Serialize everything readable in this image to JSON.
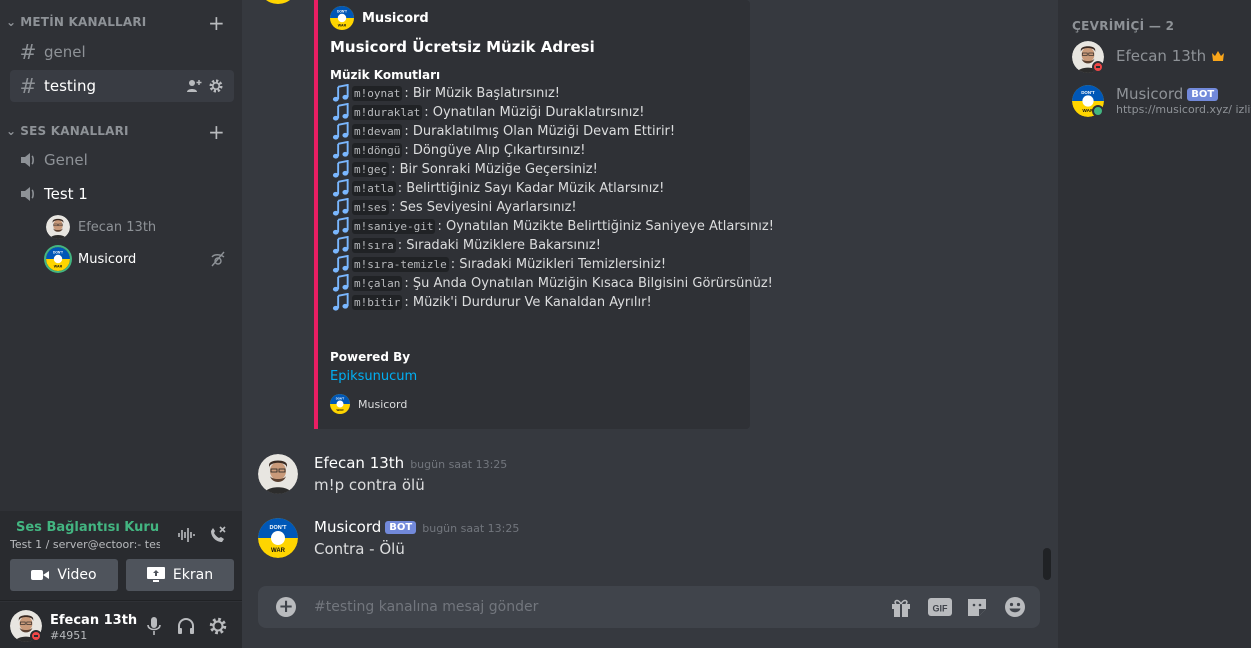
{
  "sidebar": {
    "text_category": "METİN KANALLARI",
    "voice_category": "SES KANALLARI",
    "text_channels": [
      {
        "label": "genel"
      },
      {
        "label": "testing"
      }
    ],
    "voice_channels": [
      {
        "label": "Genel"
      },
      {
        "label": "Test 1"
      }
    ],
    "voice_users": [
      {
        "name": "Efecan 13th"
      },
      {
        "name": "Musicord"
      }
    ]
  },
  "voice_panel": {
    "status": "Ses Bağlantısı Kuruldu",
    "subtitle": "Test 1 / server@ectoor:- tes...",
    "video_label": "Video",
    "screen_label": "Ekran"
  },
  "user_panel": {
    "name": "Efecan 13th",
    "tag": "#4951"
  },
  "embed": {
    "author": "Musicord",
    "title": "Musicord Ücretsiz Müzik Adresi",
    "field_name": "Müzik Komutları",
    "commands": [
      {
        "cmd": "m!oynat",
        "desc": ": Bir Müzik Başlatırsınız!"
      },
      {
        "cmd": "m!duraklat",
        "desc": ": Oynatılan Müziği Duraklatırsınız!"
      },
      {
        "cmd": "m!devam",
        "desc": ": Duraklatılmış Olan Müziği Devam Ettirir!"
      },
      {
        "cmd": "m!döngü",
        "desc": ": Döngüye Alıp Çıkartırsınız!"
      },
      {
        "cmd": "m!geç",
        "desc": ": Bir Sonraki Müziğe Geçersiniz!"
      },
      {
        "cmd": "m!atla",
        "desc": ": Belirttiğiniz Sayı Kadar Müzik Atlarsınız!"
      },
      {
        "cmd": "m!ses",
        "desc": ": Ses Seviyesini Ayarlarsınız!"
      },
      {
        "cmd": "m!saniye-git",
        "desc": ": Oynatılan Müzikte Belirttiğiniz Saniyeye Atlarsınız!"
      },
      {
        "cmd": "m!sıra",
        "desc": ": Sıradaki Müziklere Bakarsınız!"
      },
      {
        "cmd": "m!sıra-temizle",
        "desc": ": Sıradaki Müzikleri Temizlersiniz!"
      },
      {
        "cmd": "m!çalan",
        "desc": ": Şu Anda Oynatılan Müziğin Kısaca Bilgisini Görürsünüz!"
      },
      {
        "cmd": "m!bitir",
        "desc": ": Müzik'i Durdurur Ve Kanaldan Ayrılır!"
      }
    ],
    "powered_by": "Powered By",
    "powered_link": "Epiksunucum",
    "footer": "Musicord"
  },
  "messages": [
    {
      "author": "Efecan 13th",
      "time": "bugün saat 13:25",
      "text": "m!p contra ölü"
    },
    {
      "author": "Musicord",
      "badge": "BOT",
      "time": "bugün saat 13:25",
      "text": "Contra - Ölü"
    }
  ],
  "composer": {
    "placeholder": "#testing kanalına mesaj gönder"
  },
  "members": {
    "header": "ÇEVRİMİÇİ — 2",
    "list": [
      {
        "name": "Efecan 13th"
      },
      {
        "name": "Musicord",
        "badge": "BOT",
        "status": "https://musicord.xyz/ izliy"
      }
    ]
  },
  "colors": {
    "accent": "#7289da",
    "embed_bar": "#e91e63",
    "online": "#43b581",
    "dnd": "#f04747",
    "link": "#00b0f4"
  }
}
